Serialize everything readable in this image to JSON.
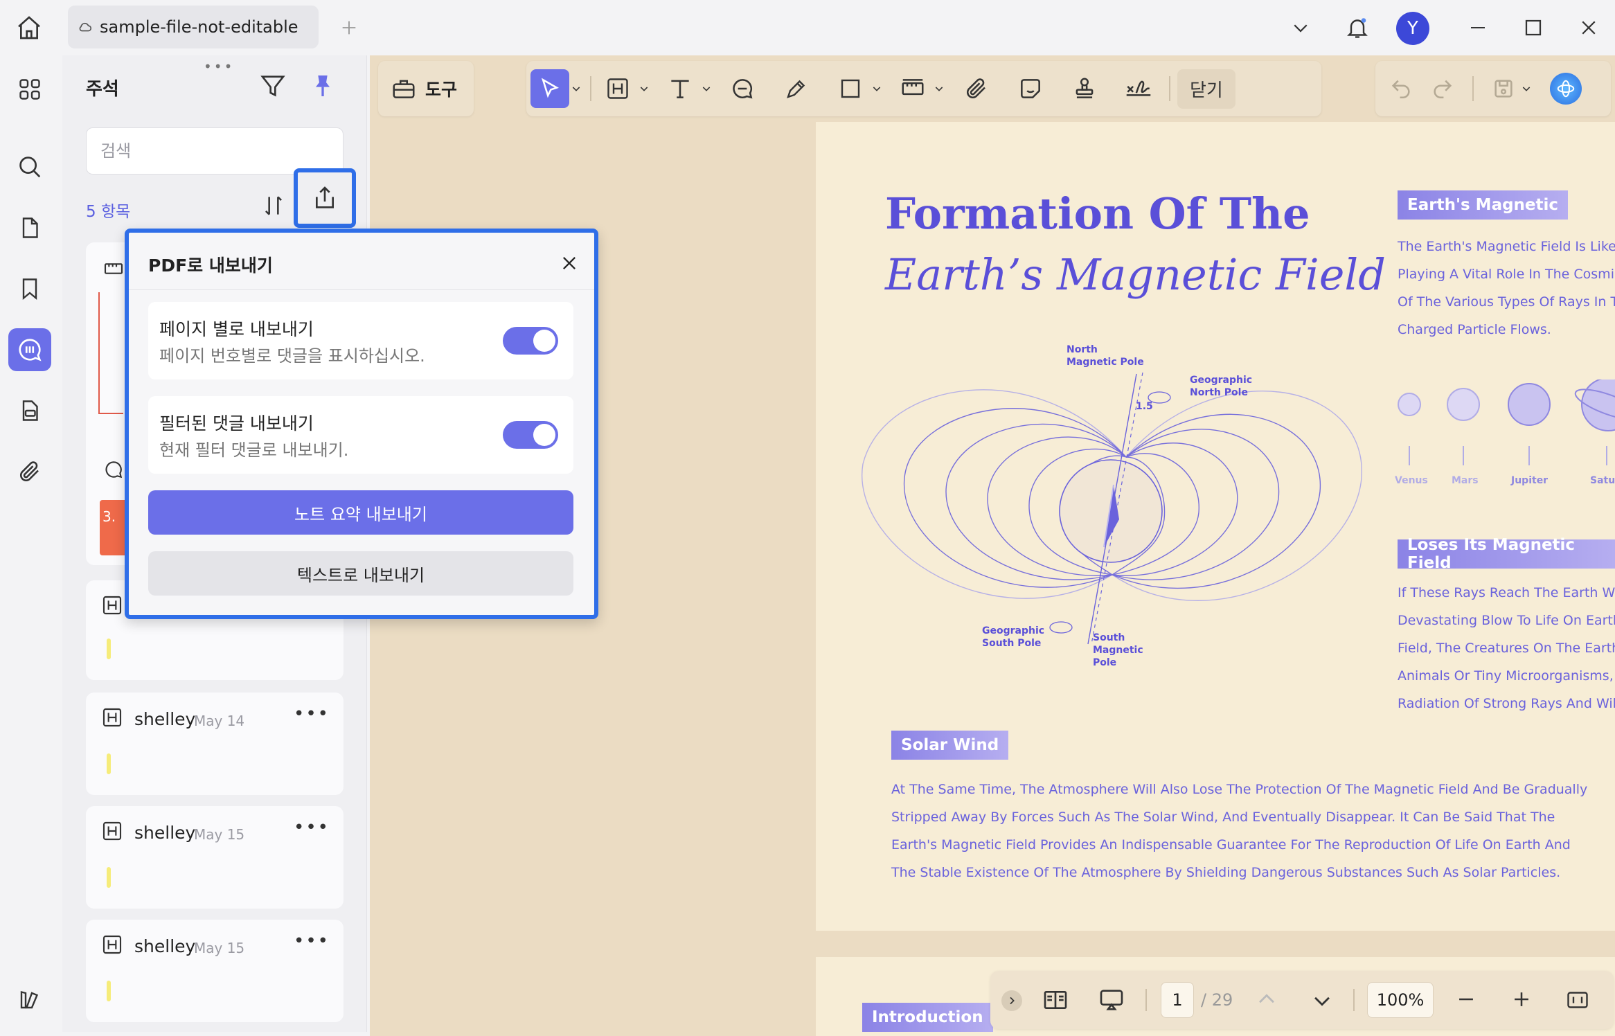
{
  "tab": {
    "title": "sample-file-not-editable"
  },
  "user": {
    "avatar_letter": "Y"
  },
  "panel": {
    "title": "주석",
    "search_placeholder": "검색",
    "count_label": "5 항목",
    "partial_badge": "3.",
    "cards": [
      {
        "author": "shelley",
        "date": "May 14"
      },
      {
        "author": "shelley",
        "date": "May 15"
      },
      {
        "author": "shelley",
        "date": "May 15"
      }
    ]
  },
  "toolbar": {
    "tools_label": "도구",
    "close_label": "닫기"
  },
  "popup": {
    "title": "PDF로 내보내기",
    "option1": {
      "title": "페이지 별로 내보내기",
      "desc": "페이지 번호별로 댓글을 표시하십시오.",
      "enabled": true
    },
    "option2": {
      "title": "필터된 댓글 내보내기",
      "desc": "현재 필터 댓글로 내보내기.",
      "enabled": true
    },
    "primary_button": "노트 요약 내보내기",
    "secondary_button": "텍스트로 내보내기"
  },
  "document": {
    "title_line1": "Formation Of The",
    "title_line2": "Earth’s Magnetic Field",
    "chip_magnetic": "Earth's Magnetic",
    "magnetic_lines": [
      "The Earth's Magnetic Field Is Like A",
      "Playing A Vital Role In The Cosmic E",
      "Of The Various Types Of Rays In Th",
      "Charged Particle Flows."
    ],
    "planets": [
      "Venus",
      "Mars",
      "Jupiter",
      "Satu"
    ],
    "chip_loses": "Loses Its Magnetic Field",
    "loses_lines": [
      "If These Rays Reach The Earth With",
      "Devastating Blow To Life On Earth.",
      "Field, The Creatures On The Earth's",
      "Animals Or Tiny Microorganisms, W",
      "Radiation Of Strong Rays And Will G"
    ],
    "chip_solar": "Solar Wind",
    "solar_lines": [
      "At The Same Time, The Atmosphere Will Also Lose The Protection Of The Magnetic Field And Be Gradually",
      "Stripped Away By Forces Such As The Solar Wind, And Eventually Disappear. It Can Be Said That The",
      "Earth's Magnetic Field Provides An Indispensable Guarantee For The Reproduction Of Life On Earth And",
      "The Stable Existence Of The Atmosphere By Shielding Dangerous Substances Such As Solar Particles."
    ],
    "diagram": {
      "north_magnetic": [
        "North",
        "Magnetic Pole"
      ],
      "geo_north": [
        "Geographic",
        "North Pole"
      ],
      "angle": "1.5",
      "geo_south": [
        "Geographic",
        "South Pole"
      ],
      "south_magnetic": [
        "South",
        "Magnetic",
        "Pole"
      ]
    },
    "chip_intro": "Introduction"
  },
  "nav": {
    "current_page": "1",
    "total_pages": "/ 29",
    "zoom": "100%"
  },
  "colors": {
    "accent": "#6b6fe8",
    "highlight_border": "#2f6ee8",
    "doc_text": "#5a4fd8",
    "page_bg": "#f7edd6"
  }
}
